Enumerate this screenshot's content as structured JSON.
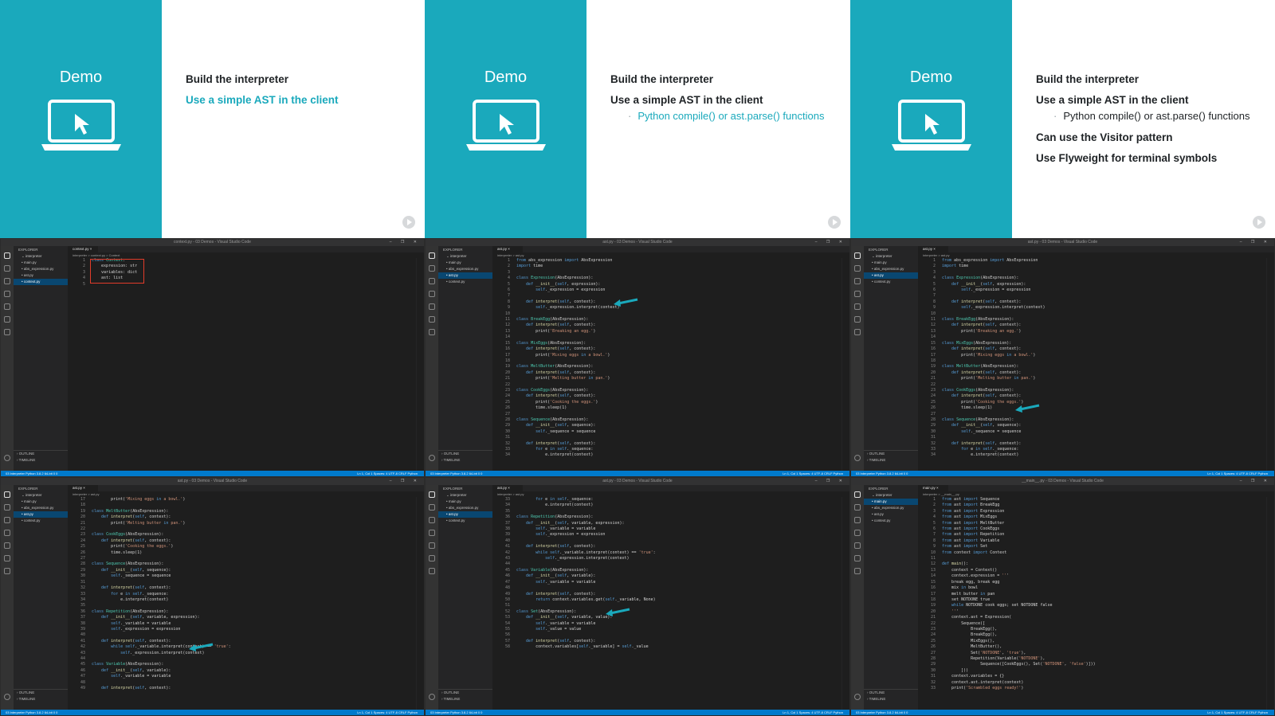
{
  "slides": [
    {
      "demo_label": "Demo",
      "items": [
        {
          "text": "Build the interpreter",
          "active": false,
          "subs": []
        },
        {
          "text": "Use a simple AST in the client",
          "active": true,
          "subs": []
        }
      ]
    },
    {
      "demo_label": "Demo",
      "items": [
        {
          "text": "Build the interpreter",
          "active": false,
          "subs": []
        },
        {
          "text": "Use a simple AST in the client",
          "active": false,
          "subs": [
            {
              "text": "Python compile() or ast.parse() functions",
              "active": true
            }
          ]
        }
      ]
    },
    {
      "demo_label": "Demo",
      "items": [
        {
          "text": "Build the interpreter",
          "active": false,
          "subs": []
        },
        {
          "text": "Use a simple AST in the client",
          "active": false,
          "subs": [
            {
              "text": "Python compile() or ast.parse() functions",
              "active": false
            }
          ]
        },
        {
          "text": "Can use the Visitor pattern",
          "active": false,
          "subs": []
        },
        {
          "text": "Use Flyweight for terminal symbols",
          "active": false,
          "subs": []
        }
      ]
    }
  ],
  "editors": [
    {
      "title": "context.py - 03 Demos - Visual Studio Code",
      "tab": "context.py",
      "breadcrumb": "interpreter > context.py > Context",
      "sidebar_header": "EXPLORER",
      "sidebar_items": [
        "interpreter",
        "main.py",
        "abs_expression.py",
        "ast.py",
        "context.py"
      ],
      "selected": 4,
      "first_line": 1,
      "lines": [
        "class Context:",
        "    expression: str",
        "    variables: dict",
        "    ast: list",
        ""
      ],
      "status_left": "03 Interpreter   Python 3.8.2 64-bit   0 0",
      "status_right": "Ln 1, Col 1   Spaces: 4   UTF-8   CRLF   Python"
    },
    {
      "title": "ast.py - 03 Demos - Visual Studio Code",
      "tab": "ast.py",
      "breadcrumb": "interpreter > ast.py",
      "sidebar_header": "EXPLORER",
      "sidebar_items": [
        "interpreter",
        "main.py",
        "abs_expression.py",
        "ast.py",
        "context.py"
      ],
      "selected": 3,
      "first_line": 1,
      "lines": [
        "from abs_expression import AbsExpression",
        "import time",
        "",
        "class Expression(AbsExpression):",
        "    def __init__(self, expression):",
        "        self._expression = expression",
        "",
        "    def interpret(self, context):",
        "        self._expression.interpret(context)",
        "",
        "class BreakEgg(AbsExpression):",
        "    def interpret(self, context):",
        "        print('Breaking an egg.')",
        "",
        "class MixEggs(AbsExpression):",
        "    def interpret(self, context):",
        "        print('Mixing eggs in a bowl.')",
        "",
        "class MeltButter(AbsExpression):",
        "    def interpret(self, context):",
        "        print('Melting butter in pan.')",
        "",
        "class CookEggs(AbsExpression):",
        "    def interpret(self, context):",
        "        print('Cooking the eggs.')",
        "        time.sleep(1)",
        "",
        "class Sequence(AbsExpression):",
        "    def __init__(self, sequence):",
        "        self._sequence = sequence",
        "",
        "    def interpret(self, context):",
        "        for e in self._sequence:",
        "            e.interpret(context)"
      ],
      "status_left": "03 Interpreter   Python 3.8.2 64-bit   0 0",
      "status_right": "Ln 1, Col 1   Spaces: 4   UTF-8   CRLF   Python"
    },
    {
      "title": "ast.py - 03 Demos - Visual Studio Code",
      "tab": "ast.py",
      "breadcrumb": "interpreter > ast.py",
      "sidebar_header": "EXPLORER",
      "sidebar_items": [
        "interpreter",
        "main.py",
        "abs_expression.py",
        "ast.py",
        "context.py"
      ],
      "selected": 3,
      "first_line": 1,
      "lines": [
        "from abs_expression import AbsExpression",
        "import time",
        "",
        "class Expression(AbsExpression):",
        "    def __init__(self, expression):",
        "        self._expression = expression",
        "",
        "    def interpret(self, context):",
        "        self._expression.interpret(context)",
        "",
        "class BreakEgg(AbsExpression):",
        "    def interpret(self, context):",
        "        print('Breaking an egg.')",
        "",
        "class MixEggs(AbsExpression):",
        "    def interpret(self, context):",
        "        print('Mixing eggs in a bowl.')",
        "",
        "class MeltButter(AbsExpression):",
        "    def interpret(self, context):",
        "        print('Melting butter in pan.')",
        "",
        "class CookEggs(AbsExpression):",
        "    def interpret(self, context):",
        "        print('Cooking the eggs.')",
        "        time.sleep(1)",
        "",
        "class Sequence(AbsExpression):",
        "    def __init__(self, sequence):",
        "        self._sequence = sequence",
        "",
        "    def interpret(self, context):",
        "        for e in self._sequence:",
        "            e.interpret(context)"
      ],
      "status_left": "03 Interpreter   Python 3.8.2 64-bit   0 0",
      "status_right": "Ln 1, Col 1   Spaces: 4   UTF-8   CRLF   Python"
    },
    {
      "title": "ast.py - 03 Demos - Visual Studio Code",
      "tab": "ast.py",
      "breadcrumb": "interpreter > ast.py",
      "sidebar_header": "EXPLORER",
      "sidebar_items": [
        "interpreter",
        "main.py",
        "abs_expression.py",
        "ast.py",
        "context.py"
      ],
      "selected": 3,
      "first_line": 17,
      "lines": [
        "        print('Mixing eggs in a bowl.')",
        "",
        "class MeltButter(AbsExpression):",
        "    def interpret(self, context):",
        "        print('Melting butter in pan.')",
        "",
        "class CookEggs(AbsExpression):",
        "    def interpret(self, context):",
        "        print('Cooking the eggs.')",
        "        time.sleep(1)",
        "",
        "class Sequence(AbsExpression):",
        "    def __init__(self, sequence):",
        "        self._sequence = sequence",
        "",
        "    def interpret(self, context):",
        "        for e in self._sequence:",
        "            e.interpret(context)",
        "",
        "class Repetition(AbsExpression):",
        "    def __init__(self, variable, expression):",
        "        self._variable = variable",
        "        self._expression = expression",
        "",
        "    def interpret(self, context):",
        "        while self._variable.interpret(context) == 'true':",
        "            self._expression.interpret(context)",
        "",
        "class Variable(AbsExpression):",
        "    def __init__(self, variable):",
        "        self._variable = variable",
        "",
        "    def interpret(self, context):"
      ],
      "status_left": "03 Interpreter   Python 3.8.2 64-bit   0 0",
      "status_right": "Ln 1, Col 1   Spaces: 4   UTF-8   CRLF   Python"
    },
    {
      "title": "ast.py - 03 Demos - Visual Studio Code",
      "tab": "ast.py",
      "breadcrumb": "interpreter > ast.py",
      "sidebar_header": "EXPLORER",
      "sidebar_items": [
        "interpreter",
        "main.py",
        "abs_expression.py",
        "ast.py",
        "context.py"
      ],
      "selected": 3,
      "first_line": 33,
      "lines": [
        "        for e in self._sequence:",
        "            e.interpret(context)",
        "",
        "class Repetition(AbsExpression):",
        "    def __init__(self, variable, expression):",
        "        self._variable = variable",
        "        self._expression = expression",
        "",
        "    def interpret(self, context):",
        "        while self._variable.interpret(context) == 'true':",
        "            self._expression.interpret(context)",
        "",
        "class Variable(AbsExpression):",
        "    def __init__(self, variable):",
        "        self._variable = variable",
        "",
        "    def interpret(self, context):",
        "        return context.variables.get(self._variable, None)",
        "",
        "class Set(AbsExpression):",
        "    def __init__(self, variable, value):",
        "        self._variable = variable",
        "        self._value = value",
        "",
        "    def interpret(self, context):",
        "        context.variables[self._variable] = self._value"
      ],
      "status_left": "03 Interpreter   Python 3.8.2 64-bit   0 0",
      "status_right": "Ln 1, Col 1   Spaces: 4   UTF-8   CRLF   Python"
    },
    {
      "title": "__main__.py - 03 Demos - Visual Studio Code",
      "tab": "main.py",
      "breadcrumb": "interpreter > __main__.py",
      "sidebar_header": "EXPLORER",
      "sidebar_items": [
        "interpreter",
        "main.py",
        "abs_expression.py",
        "ast.py",
        "context.py"
      ],
      "selected": 1,
      "first_line": 1,
      "lines": [
        "from ast import Sequence",
        "from ast import BreakEgg",
        "from ast import Expression",
        "from ast import MixEggs",
        "from ast import MeltButter",
        "from ast import CookEggs",
        "from ast import Repetition",
        "from ast import Variable",
        "from ast import Set",
        "from context import Context",
        "",
        "def main():",
        "    context = Context()",
        "    context.expression = '''",
        "    break egg, break egg",
        "    mix in bowl",
        "    melt butter in pan",
        "    set NOTDONE true",
        "    while NOTDONE cook eggs; set NOTDONE false",
        "    '''",
        "    context.ast = Expression(",
        "        Sequence([",
        "            BreakEgg(),",
        "            BreakEgg(),",
        "            MixEggs(),",
        "            MeltButter(),",
        "            Set('NOTDONE', 'true'),",
        "            Repetition(Variable('NOTDONE'),",
        "                Sequence([CookEggs(), Set('NOTDONE', 'false')]))",
        "        ]))",
        "    context.variables = {}",
        "    context.ast.interpret(context)",
        "    print('Scrambled eggs ready!')"
      ],
      "status_left": "03 Interpreter   Python 3.8.2 64-bit   0 0",
      "status_right": "Ln 1, Col 1   Spaces: 4   UTF-8   CRLF   Python"
    }
  ],
  "outline_labels": [
    "OUTLINE",
    "TIMELINE"
  ],
  "colors": {
    "teal": "#1aa9bc",
    "keyword": "#569cd6",
    "class_name": "#4ec9b0",
    "func": "#dcdcaa",
    "string": "#ce9178",
    "arrow": "#1aa9bc",
    "highlight_box": "#e23c2a"
  }
}
